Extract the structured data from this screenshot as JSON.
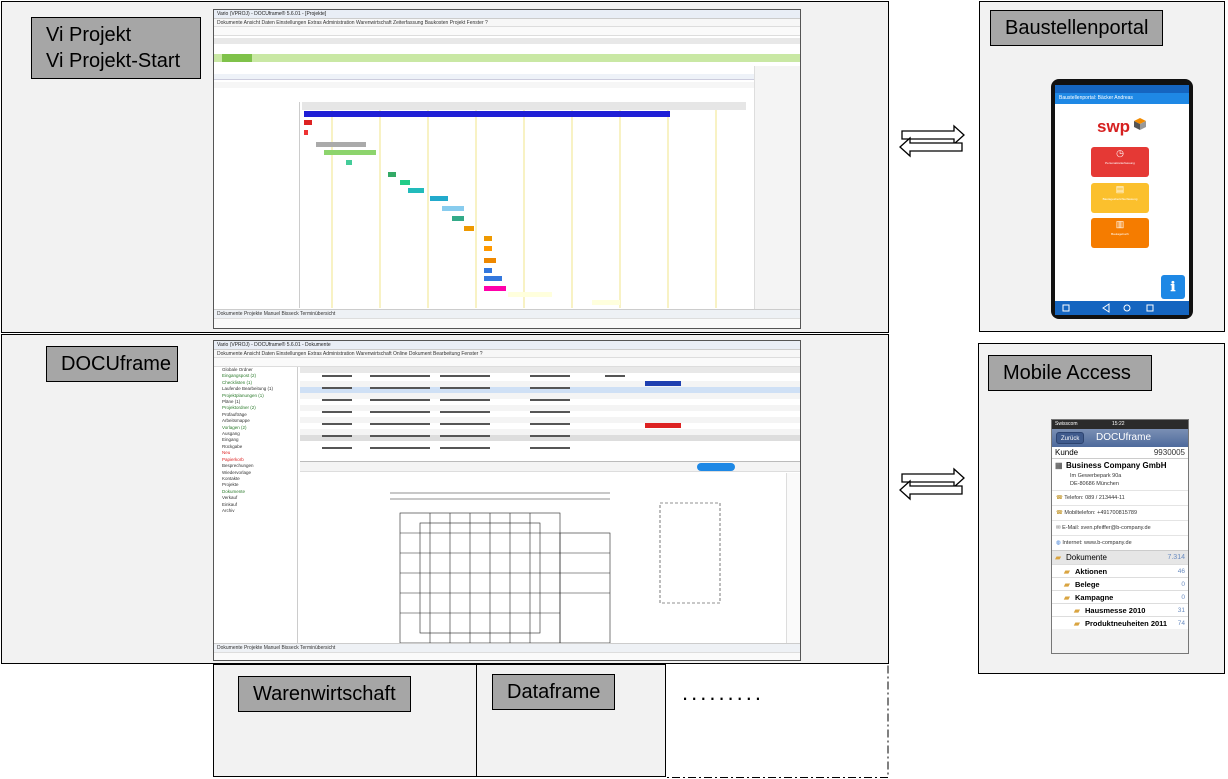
{
  "labels": {
    "vi_projekt": "Vi Projekt\nVi Projekt-Start",
    "baustellenportal": "Baustellenportal",
    "docuframe": "DOCUframe",
    "mobile_access": "Mobile Access",
    "warenwirtschaft": "Warenwirtschaft",
    "dataframe": "Dataframe",
    "more": "........."
  },
  "vi_app": {
    "title": "Vario (VPROJ) - DOCUframe® 5.6.01 - [Projekte]",
    "menu": "Dokumente  Ansicht  Daten  Einstellungen  Extras  Administration  Warenwirtschaft  Zeiterfassung  Baukosten  Projekt  Fenster  ?",
    "status": "Dokumente    Projekte    Manuel Bisseck    Terminübersicht"
  },
  "docu_app": {
    "title": "Vario (VPROJ) - DOCUframe® 5.6.01 - Dokumente",
    "menu": "Dokumente  Ansicht  Daten  Einstellungen  Extras  Administration  Warenwirtschaft  Online  Dokument  Bearbeitung  Fenster  ?",
    "status": "Dokumente    Projekte    Manuel Bisseck    Terminübersicht",
    "tree": [
      "Globale Ordner",
      "Eingangspost (2)",
      "Checklisten (1)",
      "Laufende Bearbeitung (1)",
      "Projektplanungen (1)",
      "Pläne (1)",
      "Projektordner (2)",
      "Prüfaufträge",
      "Arbeitsmappe",
      "Vorlagen (2)",
      "Ausgang",
      "Eingang",
      "Rückgabe",
      "Neu",
      "Papierkorb",
      "Besprechungen",
      "Wiedervorlage",
      "Kontakte",
      "Projekte",
      "Dokumente",
      "Verkauf",
      "Einkauf",
      "Archiv"
    ]
  },
  "baustellen_phone": {
    "header": "Baustellenportal: Bäcker Andreas",
    "logo": "swp",
    "buttons": [
      "Personalzeiterfassung",
      "Bautagesberichterfassung",
      "Bautagebuch"
    ],
    "colors": {
      "header": "#1e88e5",
      "red": "#e53935",
      "yellow": "#fbc02d",
      "orange": "#f57c00",
      "info": "#1e88e5"
    }
  },
  "mobile_phone": {
    "carrier": "Swisscom",
    "time": "15:22",
    "back": "Zurück",
    "title": "DOCUframe",
    "kunde_label": "Kunde",
    "kunde_nr": "9930005",
    "company": "Business Company GmbH",
    "address1": "Im Gewerbepark 90a",
    "address2": "DE-80686 München",
    "telefon": "Telefon: 089 / 213444-11",
    "mobil": "Mobiltelefon: +491700815789",
    "email": "E-Mail: sven.pfeiffer@b-company.de",
    "internet": "Internet: www.b-company.de",
    "dokumente_label": "Dokumente",
    "dokumente_count": "7.314",
    "items": [
      {
        "label": "Aktionen",
        "count": "46"
      },
      {
        "label": "Belege",
        "count": "0"
      },
      {
        "label": "Kampagne",
        "count": "0"
      },
      {
        "label": "Hausmesse 2010",
        "count": "31"
      },
      {
        "label": "Produktneuheiten 2011",
        "count": "74"
      }
    ]
  },
  "colors": {
    "panel": "#f2f2f2",
    "tag": "#a6a6a6",
    "gantt_bar": "#1f1fd6"
  }
}
